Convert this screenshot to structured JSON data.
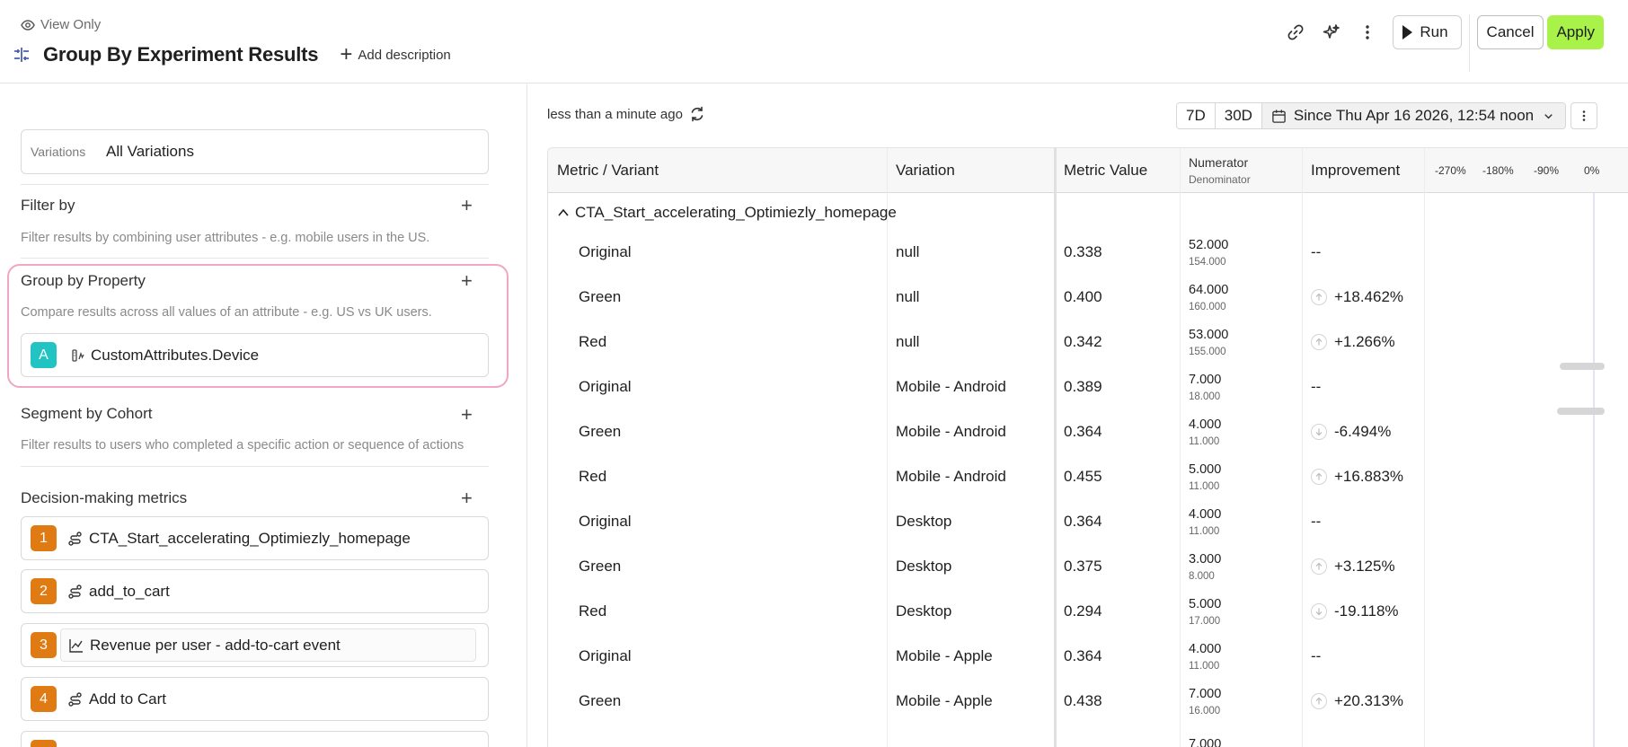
{
  "header": {
    "view_only": "View Only",
    "title": "Group By Experiment Results",
    "add_description": "Add description",
    "run_label": "Run",
    "cancel_label": "Cancel",
    "apply_label": "Apply",
    "apply_color": "#a8f24a"
  },
  "left": {
    "variations": {
      "label": "Variations",
      "value": "All Variations"
    },
    "filter": {
      "title": "Filter by",
      "description": "Filter results by combining user attributes - e.g. mobile users in the US."
    },
    "group_by": {
      "title": "Group by Property",
      "description": "Compare results across all values of an attribute - e.g. US vs UK users.",
      "property": {
        "badge": "A",
        "name": "CustomAttributes.Device"
      }
    },
    "segment": {
      "title": "Segment by Cohort",
      "description": "Filter results to users who completed a specific action or sequence of actions"
    },
    "metrics": {
      "title": "Decision-making metrics",
      "items": [
        {
          "num": "1",
          "label": "CTA_Start_accelerating_Optimiezly_homepage",
          "icon": "funnel-icon"
        },
        {
          "num": "2",
          "label": "add_to_cart",
          "icon": "funnel-icon"
        },
        {
          "num": "3",
          "label": "Revenue per user - add-to-cart event",
          "icon": "line-chart-icon"
        },
        {
          "num": "4",
          "label": "Add to Cart",
          "icon": "funnel-icon"
        }
      ]
    }
  },
  "right": {
    "updated": "less than a minute ago",
    "ranges": [
      "7D",
      "30D"
    ],
    "date_range": "Since Thu Apr 16 2026, 12:54 noon",
    "table": {
      "headers": {
        "metric": "Metric / Variant",
        "variation": "Variation",
        "metric_value": "Metric Value",
        "numerator": "Numerator",
        "denominator": "Denominator",
        "improvement": "Improvement"
      },
      "scale": [
        "-270%",
        "-180%",
        "-90%",
        "0%"
      ],
      "group": "CTA_Start_accelerating_Optimiezly_homepage",
      "rows": [
        {
          "variant": "Original",
          "variation": "null",
          "value": "0.338",
          "num": "52.000",
          "den": "154.000",
          "imp": "--",
          "dir": ""
        },
        {
          "variant": "Green",
          "variation": "null",
          "value": "0.400",
          "num": "64.000",
          "den": "160.000",
          "imp": "+18.462%",
          "dir": "up"
        },
        {
          "variant": "Red",
          "variation": "null",
          "value": "0.342",
          "num": "53.000",
          "den": "155.000",
          "imp": "+1.266%",
          "dir": "up"
        },
        {
          "variant": "Original",
          "variation": "Mobile - Android",
          "value": "0.389",
          "num": "7.000",
          "den": "18.000",
          "imp": "--",
          "dir": ""
        },
        {
          "variant": "Green",
          "variation": "Mobile - Android",
          "value": "0.364",
          "num": "4.000",
          "den": "11.000",
          "imp": "-6.494%",
          "dir": "down"
        },
        {
          "variant": "Red",
          "variation": "Mobile - Android",
          "value": "0.455",
          "num": "5.000",
          "den": "11.000",
          "imp": "+16.883%",
          "dir": "up"
        },
        {
          "variant": "Original",
          "variation": "Desktop",
          "value": "0.364",
          "num": "4.000",
          "den": "11.000",
          "imp": "--",
          "dir": ""
        },
        {
          "variant": "Green",
          "variation": "Desktop",
          "value": "0.375",
          "num": "3.000",
          "den": "8.000",
          "imp": "+3.125%",
          "dir": "up"
        },
        {
          "variant": "Red",
          "variation": "Desktop",
          "value": "0.294",
          "num": "5.000",
          "den": "17.000",
          "imp": "-19.118%",
          "dir": "down"
        },
        {
          "variant": "Original",
          "variation": "Mobile - Apple",
          "value": "0.364",
          "num": "4.000",
          "den": "11.000",
          "imp": "--",
          "dir": ""
        },
        {
          "variant": "Green",
          "variation": "Mobile - Apple",
          "value": "0.438",
          "num": "7.000",
          "den": "16.000",
          "imp": "+20.313%",
          "dir": "up"
        },
        {
          "variant": "",
          "variation": "",
          "value": "",
          "num": "7.000",
          "den": "",
          "imp": "",
          "dir": ""
        }
      ]
    }
  }
}
